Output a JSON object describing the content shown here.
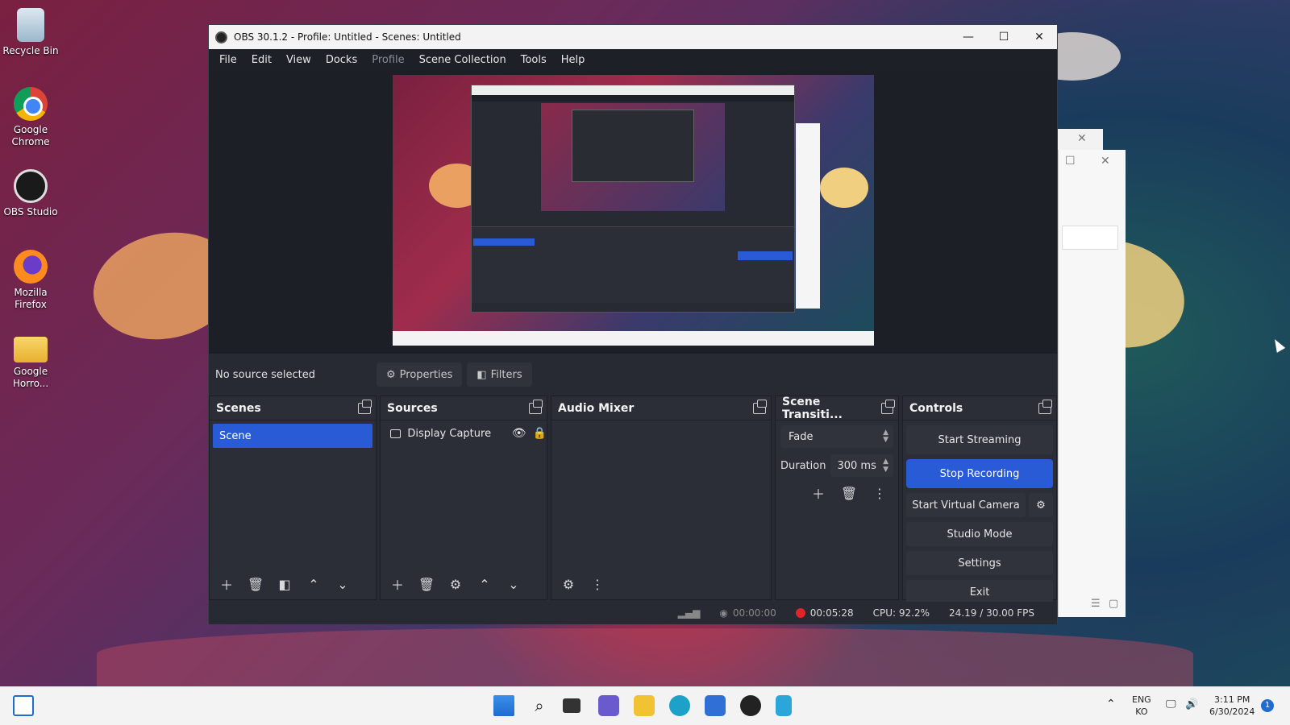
{
  "desktop": {
    "icons": [
      {
        "label": "Recycle Bin",
        "icon": "recycle-bin-icon"
      },
      {
        "label": "Google Chrome",
        "icon": "chrome-icon"
      },
      {
        "label": "OBS Studio",
        "icon": "obs-icon"
      },
      {
        "label": "Mozilla Firefox",
        "icon": "firefox-icon"
      },
      {
        "label": "Google Horro...",
        "icon": "folder-icon"
      }
    ]
  },
  "window": {
    "title": "OBS 30.1.2 - Profile: Untitled - Scenes: Untitled",
    "minimize": "—",
    "maximize": "☐",
    "close": "✕"
  },
  "menu": [
    "File",
    "Edit",
    "View",
    "Docks",
    "Profile",
    "Scene Collection",
    "Tools",
    "Help"
  ],
  "source_bar": {
    "status": "No source selected",
    "properties": "Properties",
    "filters": "Filters"
  },
  "scenes": {
    "title": "Scenes",
    "items": [
      "Scene"
    ]
  },
  "sources": {
    "title": "Sources",
    "items": [
      {
        "name": "Display Capture"
      }
    ]
  },
  "audio_mixer": {
    "title": "Audio Mixer"
  },
  "transitions": {
    "title": "Scene Transiti...",
    "selected": "Fade",
    "duration_label": "Duration",
    "duration_value": "300 ms"
  },
  "controls": {
    "title": "Controls",
    "start_streaming": "Start Streaming",
    "stop_recording": "Stop Recording",
    "start_virtual_camera": "Start Virtual Camera",
    "studio_mode": "Studio Mode",
    "settings": "Settings",
    "exit": "Exit"
  },
  "status": {
    "stream_time": "00:00:00",
    "record_time": "00:05:28",
    "cpu": "CPU: 92.2%",
    "fps": "24.19 / 30.00 FPS"
  },
  "taskbar": {
    "lang_top": "ENG",
    "lang_bottom": "KO",
    "time": "3:11 PM",
    "date": "6/30/2024",
    "notifications": "1"
  },
  "colors": {
    "accent": "#2a5bd7",
    "record": "#e0242a",
    "panel": "#2b2e37"
  }
}
